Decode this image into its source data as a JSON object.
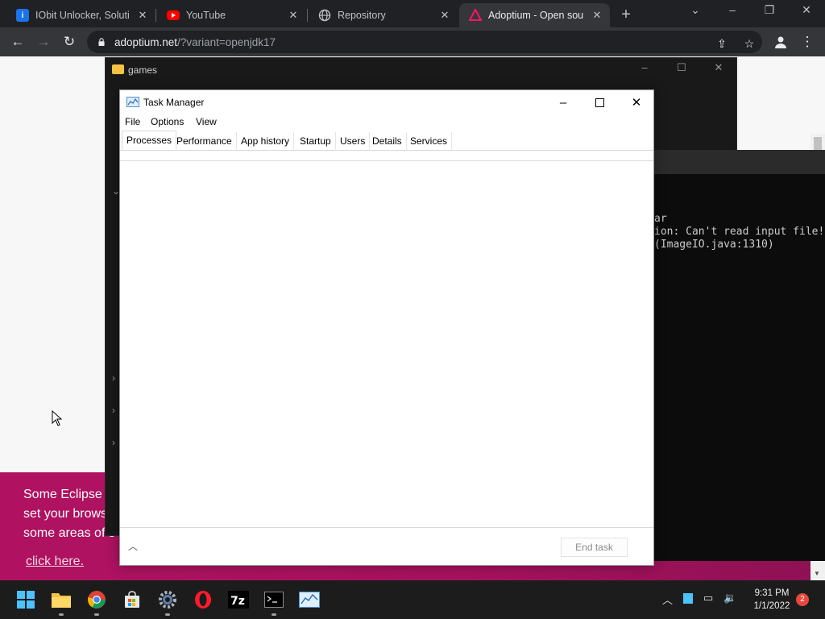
{
  "browser": {
    "tabs": [
      {
        "title": "IObit Unlocker, Solutio",
        "icon": "iobit-favicon"
      },
      {
        "title": "YouTube",
        "icon": "youtube-favicon"
      },
      {
        "title": "Repository",
        "icon": "globe-favicon"
      },
      {
        "title": "Adoptium - Open sour",
        "icon": "adoptium-favicon",
        "active": true
      }
    ],
    "url_host": "adoptium.net",
    "url_rest": "/?variant=openjdk17"
  },
  "webpage": {
    "cookie_lines": [
      "Some Eclipse",
      "set your brows",
      "some areas of s"
    ],
    "cookie_link": "click here."
  },
  "explorer": {
    "title": "games"
  },
  "console": {
    "lines": [
      "ar",
      "ion: Can't read input file!",
      "(ImageIO.java:1310)"
    ]
  },
  "taskmgr": {
    "title": "Task Manager",
    "menu": [
      "File",
      "Options",
      "View"
    ],
    "tabs": [
      "Processes",
      "Performance",
      "App history",
      "Startup",
      "Users",
      "Details",
      "Services"
    ],
    "active_tab": "Processes",
    "end_task": "End task"
  },
  "taskbar": {
    "apps": [
      "start",
      "file-explorer",
      "chrome",
      "store",
      "settings",
      "opera",
      "7zip",
      "terminal",
      "task-manager"
    ],
    "time": "9:31 PM",
    "date": "1/1/2022",
    "notifications": "2"
  },
  "colors": {
    "cookie_banner": "#b01261",
    "chrome_dark": "#202124",
    "taskbar": "#1c1c1c"
  }
}
